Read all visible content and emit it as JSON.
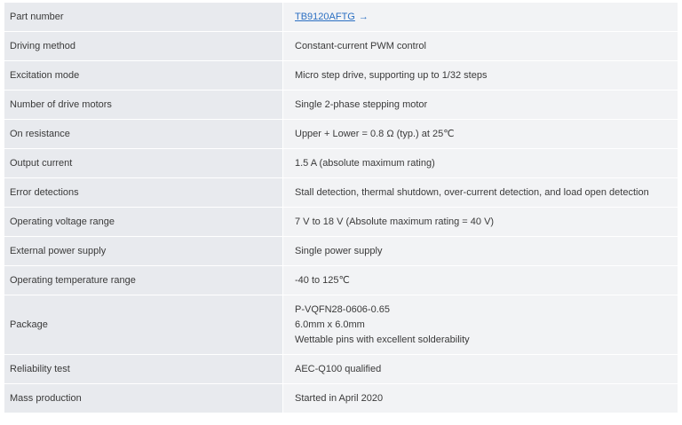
{
  "table": {
    "rows": [
      {
        "label": "Part number",
        "value": "TB9120AFTG",
        "link": true
      },
      {
        "label": "Driving method",
        "value": "Constant-current PWM control"
      },
      {
        "label": "Excitation mode",
        "value": "Micro step drive, supporting up to 1/32 steps"
      },
      {
        "label": "Number of drive motors",
        "value": "Single 2-phase stepping motor"
      },
      {
        "label": "On resistance",
        "value": "Upper + Lower = 0.8 Ω (typ.) at 25℃"
      },
      {
        "label": "Output current",
        "value": "1.5 A (absolute maximum rating)"
      },
      {
        "label": "Error detections",
        "value": "Stall detection, thermal shutdown, over-current detection, and load open detection"
      },
      {
        "label": "Operating voltage range",
        "value": "7 V to 18 V (Absolute maximum rating = 40 V)"
      },
      {
        "label": "External power supply",
        "value": "Single power supply"
      },
      {
        "label": "Operating temperature range",
        "value": "-40 to 125℃"
      },
      {
        "label": "Package",
        "lines": [
          "P-VQFN28-0606-0.65",
          "6.0mm x 6.0mm",
          "Wettable pins with excellent solderability"
        ]
      },
      {
        "label": "Reliability test",
        "value": "AEC-Q100 qualified"
      },
      {
        "label": "Mass production",
        "value": "Started in April 2020"
      }
    ],
    "link_arrow": "→"
  }
}
